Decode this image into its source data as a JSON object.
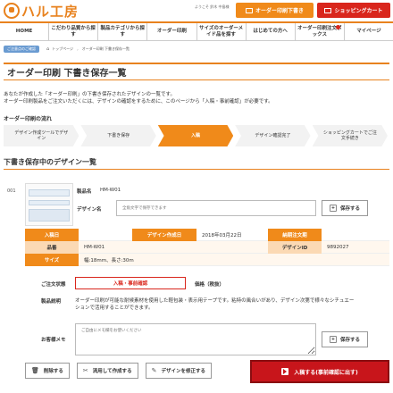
{
  "header": {
    "logo_text": "ハル工房",
    "welcome": "ようこそ 鈴木 中島様",
    "welcome_sub": "",
    "order_cart_label": "オーダー印刷下書き",
    "shop_cart_label": "ショッピングカート"
  },
  "nav": {
    "items": [
      {
        "label": "HOME"
      },
      {
        "label": "こだわり品質から探す"
      },
      {
        "label": "製品カテゴリから探す"
      },
      {
        "label": "オーダー印刷"
      },
      {
        "label": "サイズのオーダーメイド品を探す"
      },
      {
        "label": "はじめての方へ"
      },
      {
        "label": "オーダー印刷注文ボックス"
      },
      {
        "label": "マイページ"
      }
    ]
  },
  "breadcrumb": {
    "box_label": "ご注意点のご確認",
    "items": [
      "トップページ",
      "オーダー印刷 下書き保存一覧"
    ]
  },
  "page": {
    "title": "オーダー印刷 下書き保存一覧",
    "intro_line1": "あなたが作成した「オーダー印刷」の下書き保存されたデザインの一覧です。",
    "intro_line2": "オーダー印刷製品をご注文いただくには、デザインの確認をするために、このページから「入稿・事前確認」が必要です。"
  },
  "flow": {
    "title": "オーダー印刷の流れ",
    "steps": [
      {
        "label": "デザイン作成ツールでデザイン",
        "active": false
      },
      {
        "label": "下書き保存",
        "active": false
      },
      {
        "label": "入稿",
        "active": true
      },
      {
        "label": "デザイン確認完了",
        "active": false
      },
      {
        "label": "ショッピングカートでご注文手続き",
        "active": false
      }
    ]
  },
  "section": {
    "title": "下書き保存中のデザイン一覧"
  },
  "item": {
    "number": "001",
    "product_label": "製品名",
    "product_value": "HM-W01",
    "design_name_label": "デザイン名",
    "design_name_placeholder": "全角文字で保存できます",
    "save_label": "保存する",
    "save_plus": "+",
    "info": {
      "entry_label": "入稿日",
      "created_label": "デザイン作成日",
      "created_value": "2018年03月22日",
      "deadline_label": "納期注文期",
      "product_label": "品番",
      "product_value": "HM-W01",
      "design_id_label": "デザインID",
      "design_id_value": "9892027",
      "size_label": "サイズ",
      "size_value": "幅:18mm、長さ:30m"
    },
    "status_label": "ご注文状態",
    "status_value": "入稿・事前確認",
    "price_label": "価格（税抜）",
    "desc_label": "製品説明",
    "desc_line1": "オーダー印刷が可能な耐候素材を使用した軽包装・表示用テープです。粘特の風合いがあり、デザイン次第で様々なシチュエー",
    "desc_line2": "ションで活用することができます。",
    "memo_label": "お客様メモ",
    "memo_placeholder": "ご自由にメモ欄をお使いください",
    "memo_save_label": "保存する",
    "memo_save_plus": "+"
  },
  "actions": {
    "delete_label": "削除する",
    "reuse_label": "流用して作成する",
    "edit_label": "デザインを修正する",
    "submit_label": "入稿する(事前確認に出す)"
  },
  "colors": {
    "accent_orange": "#f08a1a",
    "accent_red": "#d9261c",
    "submit_red": "#c8151b"
  }
}
